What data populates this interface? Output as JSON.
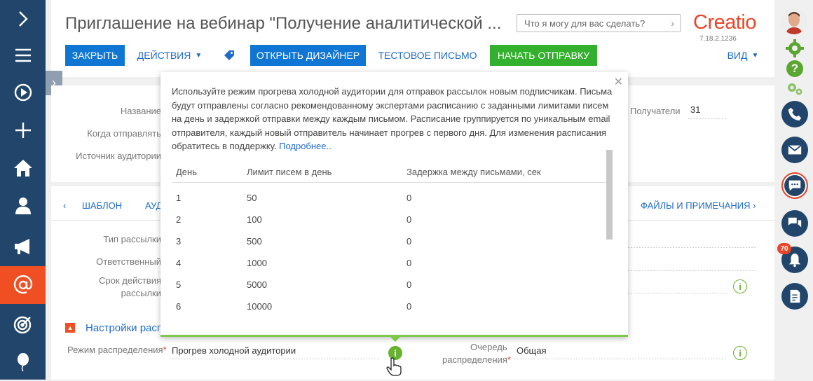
{
  "header": {
    "title": "Приглашение на вебинар \"Получение аналитической ...",
    "search_placeholder": "Что я могу для вас сделать?",
    "logo": "Creatio",
    "version": "7.18.2.1236",
    "buttons": {
      "close": "ЗАКРЫТЬ",
      "actions": "ДЕЙСТВИЯ",
      "open_designer": "ОТКРЫТЬ ДИЗАЙНЕР",
      "test_email": "ТЕСТОВОЕ ПИСЬМО",
      "start_sending": "НАЧАТЬ ОТПРАВКУ",
      "view": "ВИД"
    }
  },
  "card1": {
    "name_label": "Название",
    "when_label": "Когда отправлять",
    "source_label": "Источник аудитории",
    "recipients_label": "Получатели",
    "recipients_value": "31"
  },
  "tabs": {
    "template": "ШАБЛОН",
    "audience_partial": "АУД",
    "files": "ФАЙЛЫ И ПРИМЕЧАНИЯ"
  },
  "card2": {
    "type_label": "Тип рассылки",
    "owner_label": "Ответственный",
    "term_label_1": "Срок действия",
    "term_label_2": "рассылки",
    "section_title": "Настройки расп",
    "distribution_mode_label": "Режим распределения",
    "distribution_mode_value": "Прогрев холодной аудитории",
    "queue_label_1": "Очередь",
    "queue_label_2": "распределения",
    "queue_value": "Общая"
  },
  "popup": {
    "text": "Используйте режим прогрева холодной аудитории для отправок рассылок новым подписчикам. Письма будут отправлены согласно рекомендованному экспертами расписанию с заданными лимитами писем на день и задержкой отправки между каждым письмом. Расписание группируется по уникальным email отправителя, каждый новый отправитель начинает прогрев с первого дня. Для изменения расписания обратитесь в поддержку.",
    "link": "Подробнее..",
    "columns": [
      "День",
      "Лимит писем в день",
      "Задержка между письмами, сек"
    ],
    "rows": [
      [
        "1",
        "50",
        "0"
      ],
      [
        "2",
        "100",
        "0"
      ],
      [
        "3",
        "500",
        "0"
      ],
      [
        "4",
        "1000",
        "0"
      ],
      [
        "5",
        "5000",
        "0"
      ],
      [
        "6",
        "10000",
        "0"
      ]
    ]
  },
  "rightbar": {
    "notification_count": "70"
  },
  "colors": {
    "nav_bg": "#22466b",
    "accent_orange": "#f04e23",
    "primary_blue": "#0f76d4",
    "success_green": "#33b02d",
    "info_green": "#68b22f"
  }
}
